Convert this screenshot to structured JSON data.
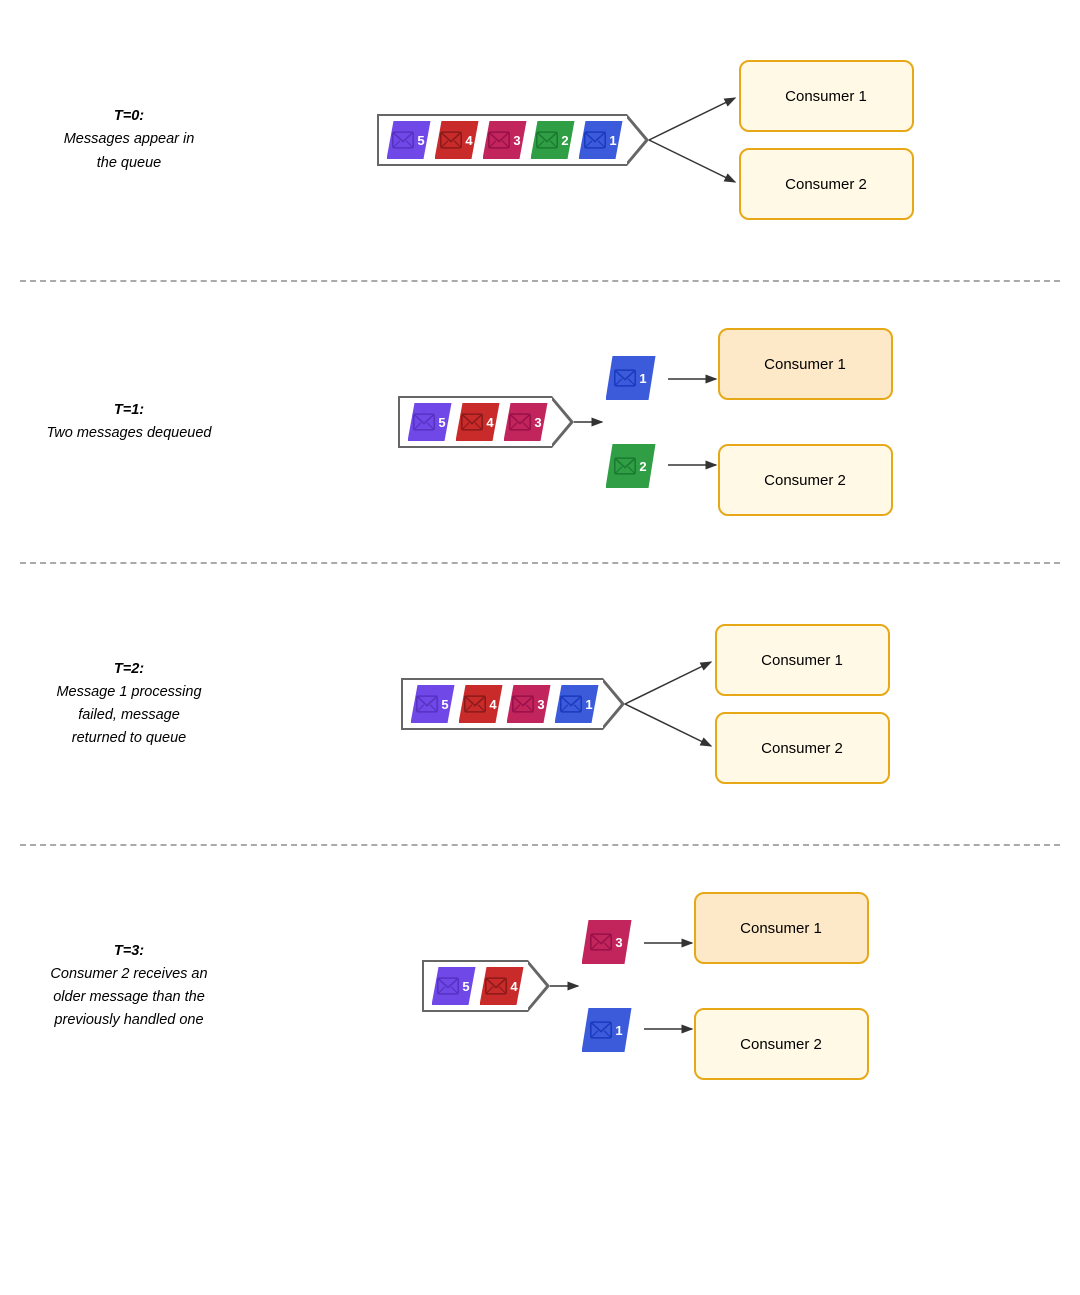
{
  "sections": [
    {
      "id": "t0",
      "time_label": "T=0:",
      "description": "Messages appear in\nthe queue",
      "queue_messages": [
        "5",
        "4",
        "3",
        "2",
        "1"
      ],
      "queue_colors": [
        "msg-5",
        "msg-4",
        "msg-3",
        "msg-2",
        "msg-1"
      ],
      "dequeued": [],
      "consumer1": "Consumer 1",
      "consumer2": "Consumer 2",
      "consumer1_active": false,
      "consumer2_active": false
    },
    {
      "id": "t1",
      "time_label": "T=1:",
      "description": "Two messages dequeued",
      "queue_messages": [
        "5",
        "4",
        "3"
      ],
      "queue_colors": [
        "msg-5",
        "msg-4",
        "msg-3"
      ],
      "dequeued": [
        {
          "num": "1",
          "color": "msg-1",
          "consumer": 1
        },
        {
          "num": "2",
          "color": "msg-2",
          "consumer": 2
        }
      ],
      "consumer1": "Consumer 1",
      "consumer2": "Consumer 2",
      "consumer1_active": true,
      "consumer2_active": false
    },
    {
      "id": "t2",
      "time_label": "T=2:",
      "description": "Message 1 processing\nfailed, message\nreturned to queue",
      "queue_messages": [
        "5",
        "4",
        "3",
        "1"
      ],
      "queue_colors": [
        "msg-5",
        "msg-4",
        "msg-3",
        "msg-1"
      ],
      "dequeued": [],
      "consumer1": "Consumer 1",
      "consumer2": "Consumer 2",
      "consumer1_active": false,
      "consumer2_active": false
    },
    {
      "id": "t3",
      "time_label": "T=3:",
      "description": "Consumer 2 receives an\nolder message than the\npreviously handled one",
      "queue_messages": [
        "5",
        "4"
      ],
      "queue_colors": [
        "msg-5",
        "msg-4"
      ],
      "dequeued": [
        {
          "num": "3",
          "color": "msg-3",
          "consumer": 1
        },
        {
          "num": "1",
          "color": "msg-1",
          "consumer": 2
        }
      ],
      "consumer1": "Consumer 1",
      "consumer2": "Consumer 2",
      "consumer1_active": true,
      "consumer2_active": false
    }
  ]
}
